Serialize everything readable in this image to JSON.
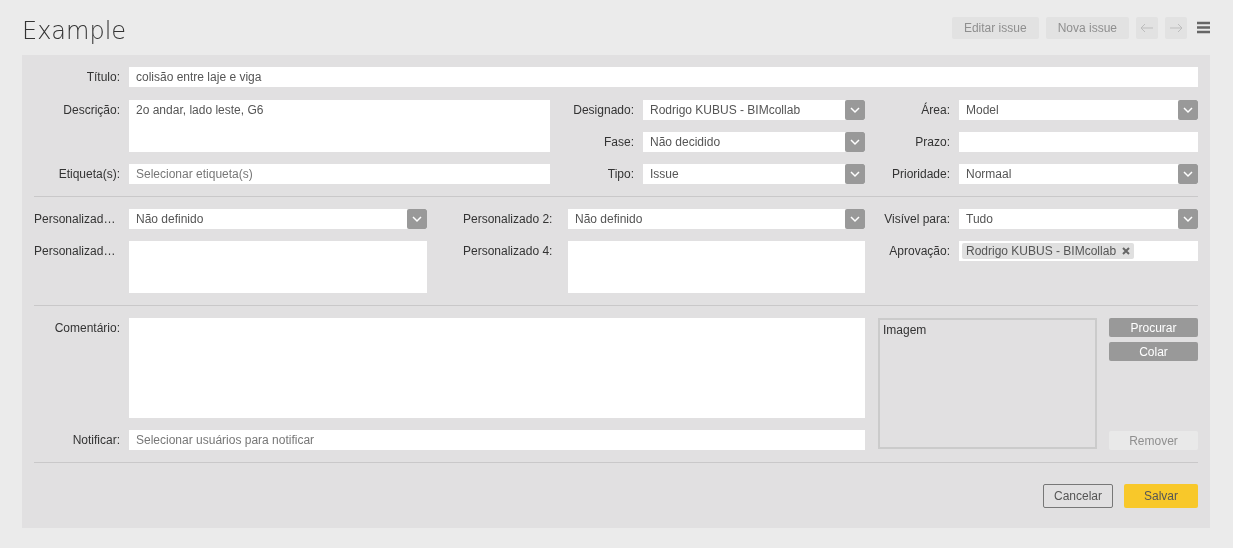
{
  "header": {
    "title": "Example",
    "toolbar": [
      {
        "kind": "text",
        "label": "Editar issue",
        "disabled": true
      },
      {
        "kind": "text",
        "label": "Nova issue",
        "disabled": true
      },
      {
        "kind": "prev",
        "disabled": true
      },
      {
        "kind": "next",
        "disabled": true
      },
      {
        "kind": "menu",
        "disabled": false
      }
    ]
  },
  "details": {
    "title_field": {
      "label": "Título:",
      "value": "colisão entre laje e viga"
    },
    "columns": [
      [
        {
          "kind": "textarea",
          "label": "Descrição:",
          "value": "2o andar, lado leste, G6"
        },
        {
          "kind": "text",
          "label": "Etiqueta(s):",
          "placeholder": "Selecionar etiqueta(s)"
        }
      ],
      [
        {
          "kind": "select",
          "label": "Designado:",
          "value": "Rodrigo KUBUS - BIMcollab"
        },
        {
          "kind": "select",
          "label": "Fase:",
          "value": "Não decidido"
        },
        {
          "kind": "select",
          "label": "Tipo:",
          "value": "Issue"
        }
      ],
      [
        {
          "kind": "select",
          "label": "Área:",
          "value": "Model"
        },
        {
          "kind": "text",
          "label": "Prazo:"
        },
        {
          "kind": "select",
          "label": "Prioridade:",
          "value": "Normaal"
        }
      ]
    ]
  },
  "custom": {
    "columns": [
      [
        {
          "kind": "select",
          "label": "Personalizad…",
          "value": "Não definido"
        },
        {
          "kind": "textarea",
          "label": "Personalizad…"
        }
      ],
      [
        {
          "kind": "select",
          "label": "Personalizado 2:",
          "value": "Não definido"
        },
        {
          "kind": "textarea",
          "label": "Personalizado 4:"
        }
      ],
      [
        {
          "kind": "select",
          "label": "Visível para:",
          "value": "Tudo"
        },
        {
          "kind": "tags",
          "label": "Aprovação:",
          "tags": [
            "Rodrigo KUBUS - BIMcollab"
          ]
        }
      ]
    ]
  },
  "comment": {
    "comment_field": {
      "label": "Comentário:"
    },
    "notify_field": {
      "label": "Notificar:",
      "placeholder": "Selecionar usuários para notificar"
    },
    "image": {
      "label": "Imagem"
    },
    "image_buttons": [
      {
        "label": "Procurar",
        "disabled": false
      },
      {
        "label": "Colar",
        "disabled": false
      },
      {
        "label": "Remover",
        "disabled": true
      }
    ]
  },
  "footer": {
    "buttons": [
      {
        "kind": "secondary",
        "label": "Cancelar"
      },
      {
        "kind": "primary",
        "label": "Salvar"
      }
    ]
  }
}
